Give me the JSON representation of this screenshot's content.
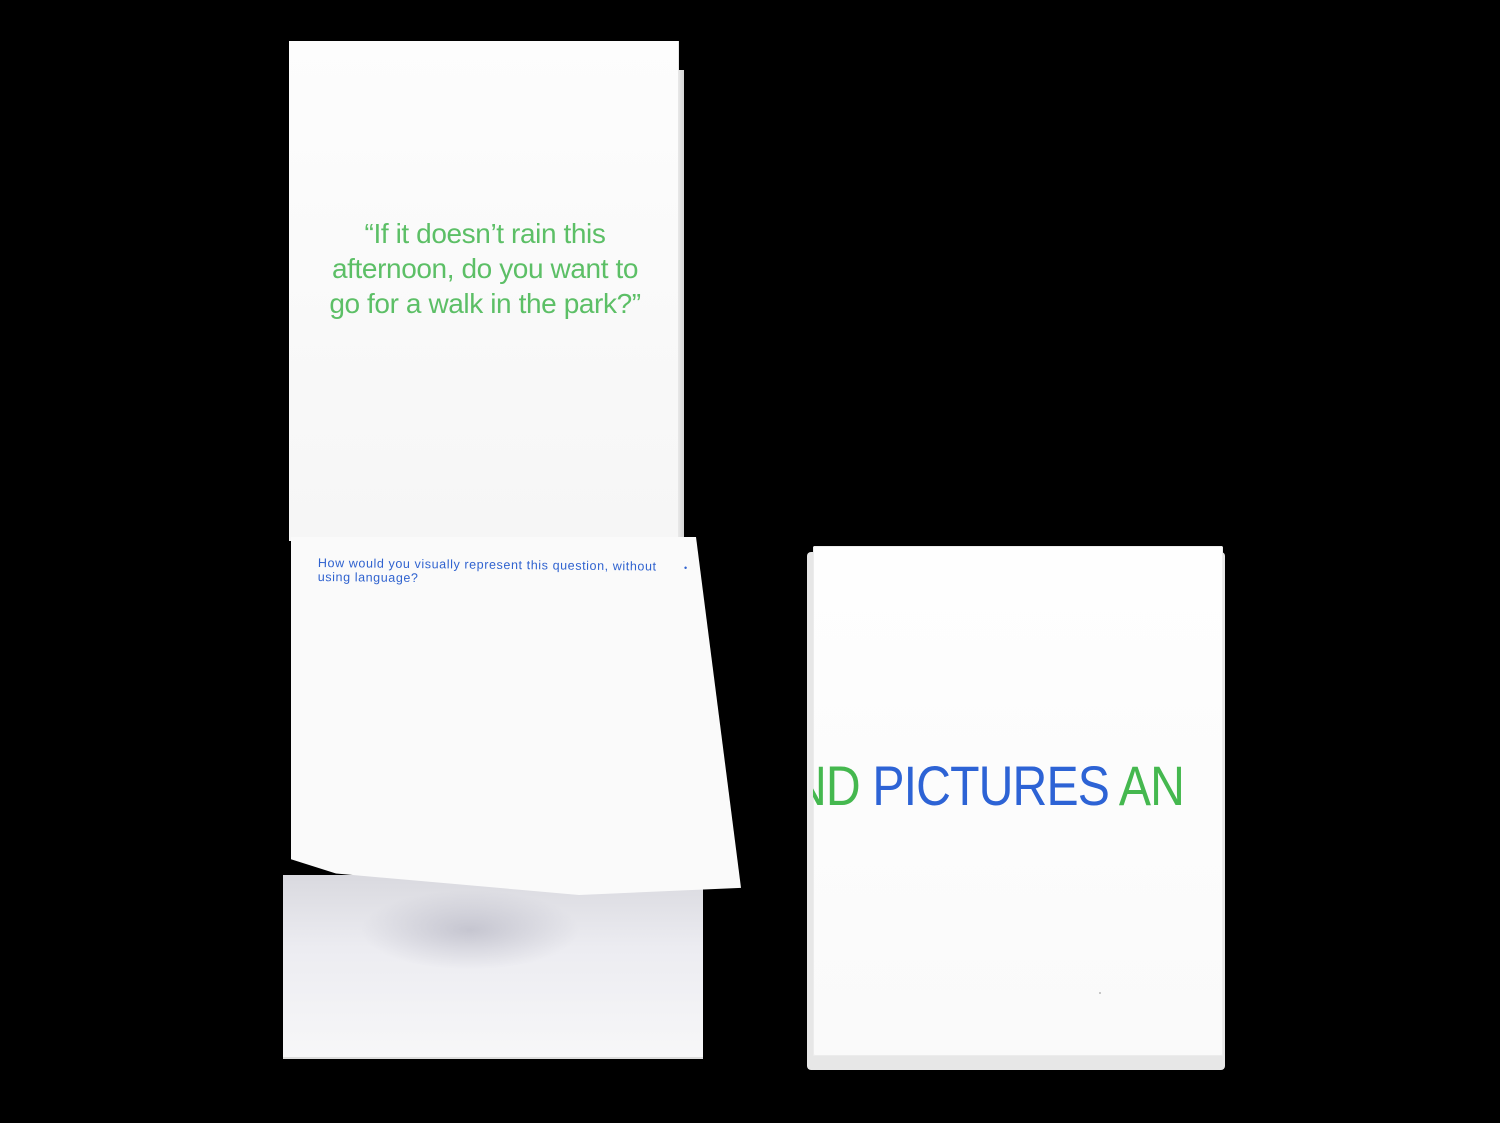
{
  "booklet": {
    "quote_text": "“If it doesn’t rain this afternoon, do you want to go for a walk in the park?”",
    "flap_question": "How would you visually represent this question, without using language?"
  },
  "card_pad": {
    "cover_text_left": "ND ",
    "cover_text_middle": "PICTURES",
    "cover_text_right": " AN"
  },
  "colors": {
    "background": "#000000",
    "paper": "#fafafa",
    "quote_green": "#5cbf66",
    "cover_green": "#45b84f",
    "question_blue": "#2f62cf",
    "cover_blue": "#2d63d5"
  }
}
